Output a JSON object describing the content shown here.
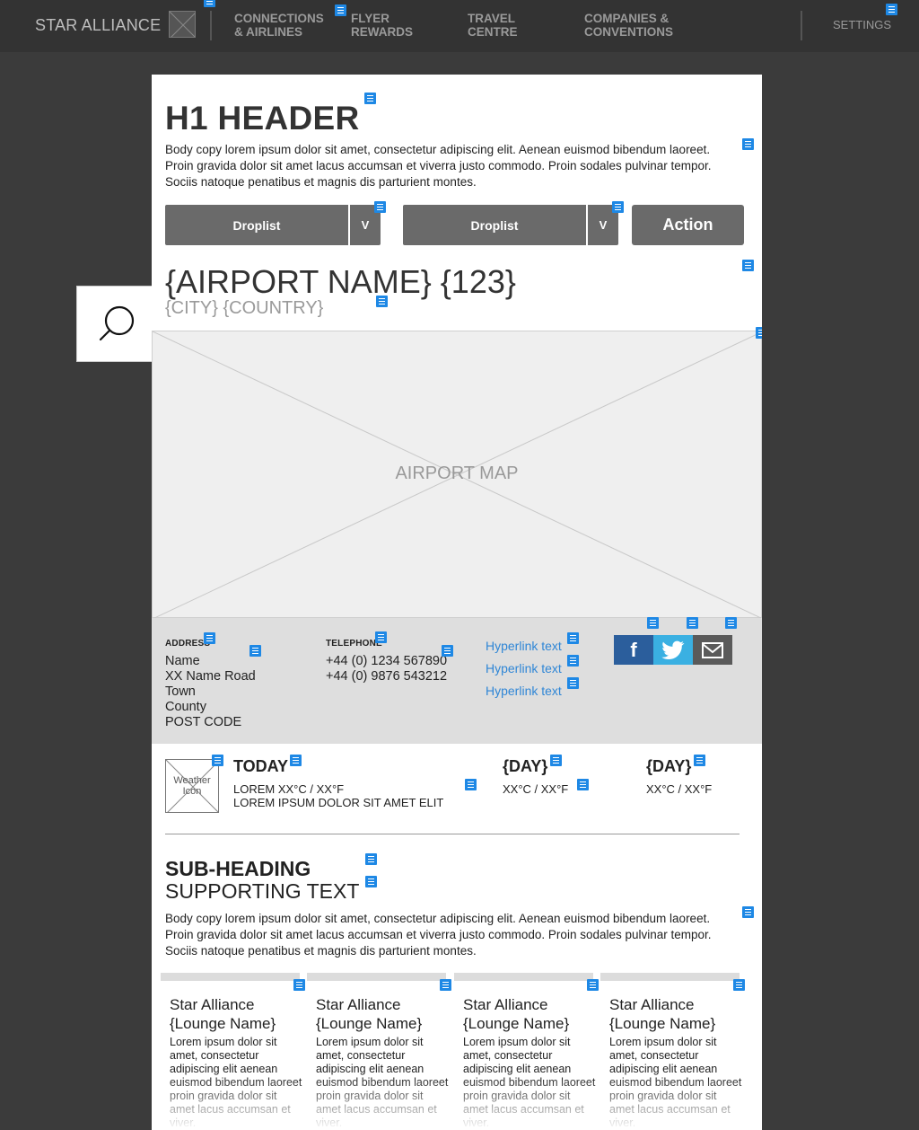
{
  "nav": {
    "brand": "STAR ALLIANCE",
    "items": [
      {
        "line1": "CONNECTIONS",
        "line2": "& AIRLINES"
      },
      {
        "line1": "FLYER",
        "line2": "REWARDS"
      },
      {
        "line1": "TRAVEL",
        "line2": "CENTRE"
      },
      {
        "line1": "COMPANIES &",
        "line2": "CONVENTIONS"
      }
    ],
    "settings": "SETTINGS"
  },
  "main": {
    "h1": "H1 HEADER",
    "body_copy": "Body copy lorem ipsum dolor sit amet, consectetur adipiscing elit. Aenean euismod bibendum laoreet. Proin gravida dolor sit amet lacus accumsan et viverra justo commodo. Proin sodales pulvinar tempor. Sociis natoque penatibus et magnis dis parturient montes.",
    "droplist1": {
      "label": "Droplist",
      "arrow": "V"
    },
    "droplist2": {
      "label": "Droplist",
      "arrow": "V"
    },
    "action": "Action",
    "airport_name": "{AIRPORT NAME} {123}",
    "airport_location": "{CITY} {COUNTRY}",
    "map_label": "AIRPORT MAP"
  },
  "contact": {
    "address_label": "ADDRESS",
    "address_lines": [
      "Name",
      "XX Name Road",
      "Town",
      "County",
      "POST CODE"
    ],
    "telephone_label": "TELEPHONE",
    "phones": [
      "+44 (0) 1234 567890",
      "+44 (0) 9876 543212"
    ],
    "links": [
      "Hyperlink text",
      "Hyperlink text",
      "Hyperlink text"
    ],
    "social": {
      "facebook": {
        "icon": "facebook-icon",
        "glyph": "f",
        "color": "#2b5e9c"
      },
      "twitter": {
        "icon": "twitter-icon",
        "color": "#3ab0e2"
      },
      "email": {
        "icon": "mail-icon",
        "color": "#5a5a5a"
      }
    }
  },
  "weather": {
    "icon_label": "Weather Icon",
    "today": {
      "title": "TODAY",
      "line1": "LOREM XX°C / XX°F",
      "line2": "LOREM IPSUM DOLOR SIT AMET ELIT"
    },
    "days": [
      {
        "title": "{DAY}",
        "temp": "XX°C / XX°F"
      },
      {
        "title": "{DAY}",
        "temp": "XX°C / XX°F"
      }
    ]
  },
  "section": {
    "subheading": "SUB-HEADING",
    "supporting": "SUPPORTING TEXT",
    "body_copy": "Body copy lorem ipsum dolor sit amet, consectetur adipiscing elit. Aenean euismod bibendum laoreet. Proin gravida dolor sit amet lacus accumsan et viverra justo commodo. Proin sodales pulvinar tempor. Sociis natoque penatibus et magnis dis parturient montes."
  },
  "lounges": [
    {
      "title1": "Star Alliance",
      "title2": "{Lounge Name}",
      "text": "Lorem ipsum dolor sit amet, consectetur adipiscing elit aenean euismod bibendum laoreet proin gravida dolor sit amet lacus accumsan et viver."
    },
    {
      "title1": "Star Alliance",
      "title2": "{Lounge Name}",
      "text": "Lorem ipsum dolor sit amet, consectetur adipiscing elit aenean euismod bibendum laoreet proin gravida dolor sit amet lacus accumsan et viver."
    },
    {
      "title1": "Star Alliance",
      "title2": "{Lounge Name}",
      "text": "Lorem ipsum dolor sit amet, consectetur adipiscing elit aenean euismod bibendum laoreet proin gravida dolor sit amet lacus accumsan et viver."
    },
    {
      "title1": "Star Alliance",
      "title2": "{Lounge Name}",
      "text": "Lorem ipsum dolor sit amet, consectetur adipiscing elit aenean euismod bibendum laoreet proin gravida dolor sit amet lacus accumsan et viver."
    }
  ]
}
